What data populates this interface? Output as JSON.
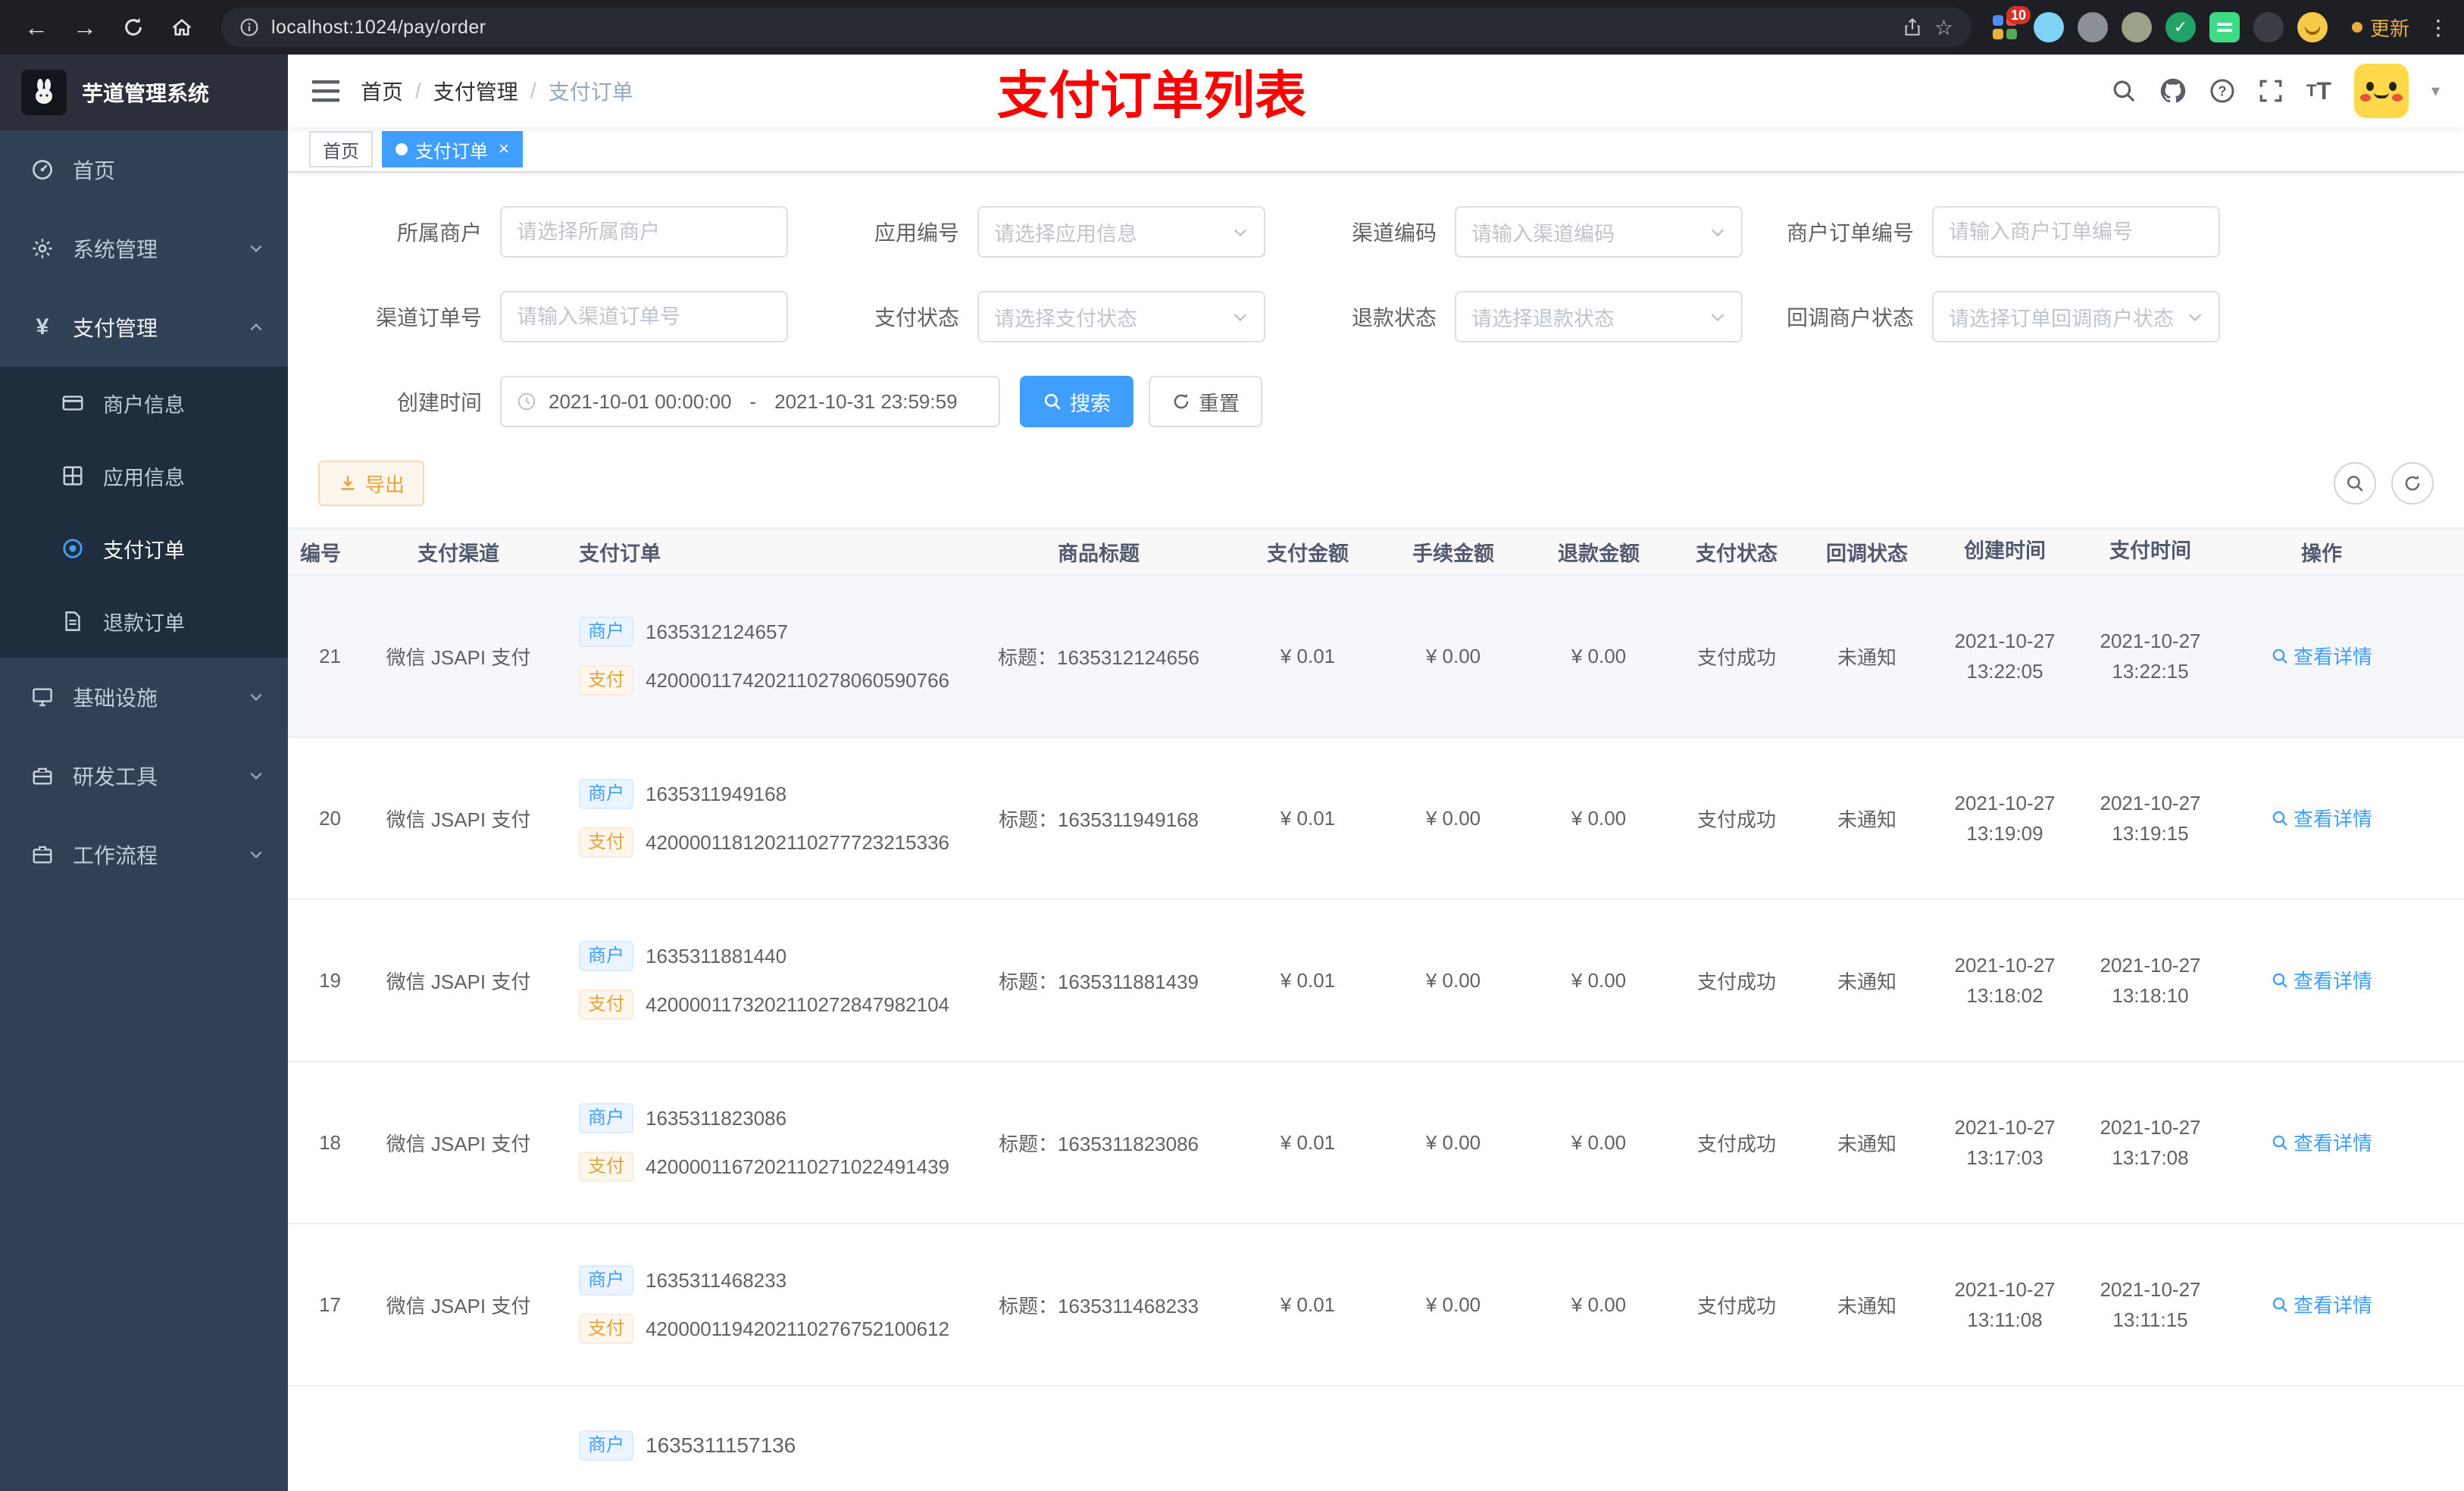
{
  "browser": {
    "url": "localhost:1024/pay/order",
    "update_label": "更新",
    "ext_badge": "10"
  },
  "sidebar": {
    "logo_title": "芋道管理系统",
    "menu": [
      {
        "label": "首页"
      },
      {
        "label": "系统管理"
      },
      {
        "label": "支付管理"
      },
      {
        "label": "基础设施"
      },
      {
        "label": "研发工具"
      },
      {
        "label": "工作流程"
      }
    ],
    "submenu": [
      {
        "label": "商户信息"
      },
      {
        "label": "应用信息"
      },
      {
        "label": "支付订单"
      },
      {
        "label": "退款订单"
      }
    ]
  },
  "navbar": {
    "breadcrumb": [
      "首页",
      "支付管理",
      "支付订单"
    ],
    "page_title": "支付订单列表"
  },
  "tags": {
    "home": "首页",
    "current": "支付订单"
  },
  "filters": {
    "items": [
      {
        "label": "所属商户",
        "placeholder": "请选择所属商户"
      },
      {
        "label": "应用编号",
        "placeholder": "请选择应用信息"
      },
      {
        "label": "渠道编码",
        "placeholder": "请输入渠道编码"
      },
      {
        "label": "商户订单编号",
        "placeholder": "请输入商户订单编号"
      },
      {
        "label": "渠道订单号",
        "placeholder": "请输入渠道订单号"
      },
      {
        "label": "支付状态",
        "placeholder": "请选择支付状态"
      },
      {
        "label": "退款状态",
        "placeholder": "请选择退款状态"
      },
      {
        "label": "回调商户状态",
        "placeholder": "请选择订单回调商户状态"
      }
    ],
    "create_time_label": "创建时间",
    "date_start": "2021-10-01 00:00:00",
    "date_sep": "-",
    "date_end": "2021-10-31 23:59:59",
    "search_label": "搜索",
    "reset_label": "重置"
  },
  "toolbar": {
    "export_label": "导出"
  },
  "table": {
    "badge_merchant": "商户",
    "badge_pay": "支付",
    "title_prefix": "标题：",
    "action_label": "查看详情",
    "headers": [
      "编号",
      "支付渠道",
      "支付订单",
      "商品标题",
      "支付金额",
      "手续金额",
      "退款金额",
      "支付状态",
      "回调状态",
      "创建时间",
      "支付时间",
      "操作"
    ],
    "rows": [
      {
        "id": "21",
        "channel": "微信 JSAPI 支付",
        "merchant_no": "1635312124657",
        "pay_no": "4200001174202110278060590766",
        "title": "1635312124656",
        "pay_amount": "¥ 0.01",
        "fee_amount": "¥ 0.00",
        "refund_amount": "¥ 0.00",
        "status": "支付成功",
        "notify": "未通知",
        "create_date": "2021-10-27",
        "create_time": "13:22:05",
        "pay_date": "2021-10-27",
        "pay_time": "13:22:15"
      },
      {
        "id": "20",
        "channel": "微信 JSAPI 支付",
        "merchant_no": "1635311949168",
        "pay_no": "4200001181202110277723215336",
        "title": "1635311949168",
        "pay_amount": "¥ 0.01",
        "fee_amount": "¥ 0.00",
        "refund_amount": "¥ 0.00",
        "status": "支付成功",
        "notify": "未通知",
        "create_date": "2021-10-27",
        "create_time": "13:19:09",
        "pay_date": "2021-10-27",
        "pay_time": "13:19:15"
      },
      {
        "id": "19",
        "channel": "微信 JSAPI 支付",
        "merchant_no": "1635311881440",
        "pay_no": "4200001173202110272847982104",
        "title": "1635311881439",
        "pay_amount": "¥ 0.01",
        "fee_amount": "¥ 0.00",
        "refund_amount": "¥ 0.00",
        "status": "支付成功",
        "notify": "未通知",
        "create_date": "2021-10-27",
        "create_time": "13:18:02",
        "pay_date": "2021-10-27",
        "pay_time": "13:18:10"
      },
      {
        "id": "18",
        "channel": "微信 JSAPI 支付",
        "merchant_no": "1635311823086",
        "pay_no": "4200001167202110271022491439",
        "title": "1635311823086",
        "pay_amount": "¥ 0.01",
        "fee_amount": "¥ 0.00",
        "refund_amount": "¥ 0.00",
        "status": "支付成功",
        "notify": "未通知",
        "create_date": "2021-10-27",
        "create_time": "13:17:03",
        "pay_date": "2021-10-27",
        "pay_time": "13:17:08"
      },
      {
        "id": "17",
        "channel": "微信 JSAPI 支付",
        "merchant_no": "1635311468233",
        "pay_no": "4200001194202110276752100612",
        "title": "1635311468233",
        "pay_amount": "¥ 0.01",
        "fee_amount": "¥ 0.00",
        "refund_amount": "¥ 0.00",
        "status": "支付成功",
        "notify": "未通知",
        "create_date": "2021-10-27",
        "create_time": "13:11:08",
        "pay_date": "2021-10-27",
        "pay_time": "13:11:15"
      }
    ],
    "partial_row": {
      "merchant_no": "1635311157136"
    }
  },
  "colors": {
    "accent": "#409eff",
    "warning": "#e6a23c",
    "title_red": "#ff0000"
  }
}
